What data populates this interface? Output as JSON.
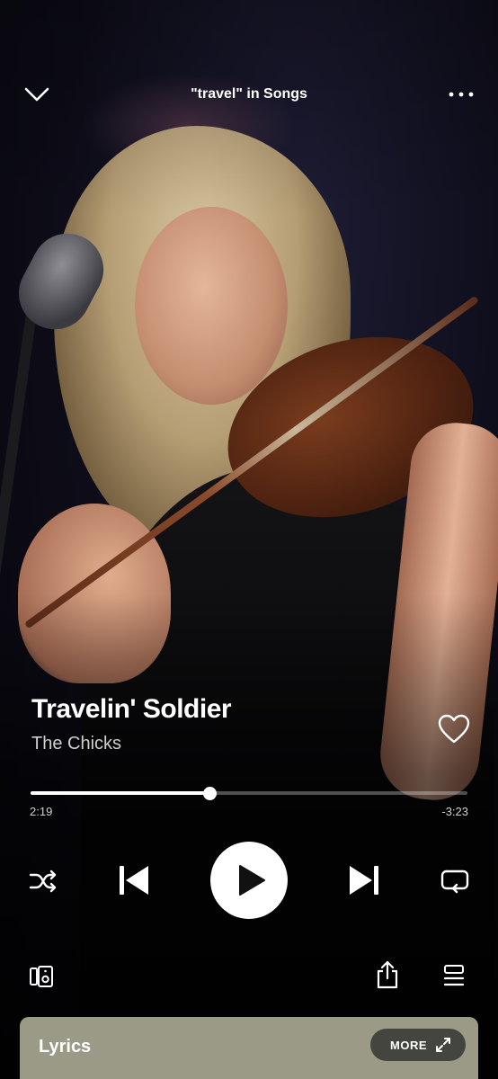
{
  "header": {
    "title": "\"travel\" in Songs",
    "collapse_icon": "chevron-down-icon",
    "options_icon": "more-horizontal-icon"
  },
  "track": {
    "title": "Travelin' Soldier",
    "artist": "The Chicks",
    "liked": false
  },
  "playback": {
    "elapsed": "2:19",
    "remaining": "-3:23",
    "progress_fraction": 0.41,
    "is_playing": false
  },
  "controls": [
    "shuffle-icon",
    "skip-previous-icon",
    "play-icon",
    "skip-next-icon",
    "repeat-icon"
  ],
  "bottom_bar": [
    "devices-icon",
    "share-icon",
    "queue-icon"
  ],
  "lyrics": {
    "label": "Lyrics",
    "more_label": "MORE"
  },
  "colors": {
    "lyrics_card": "#9b9a86",
    "accent": "#ffffff"
  }
}
